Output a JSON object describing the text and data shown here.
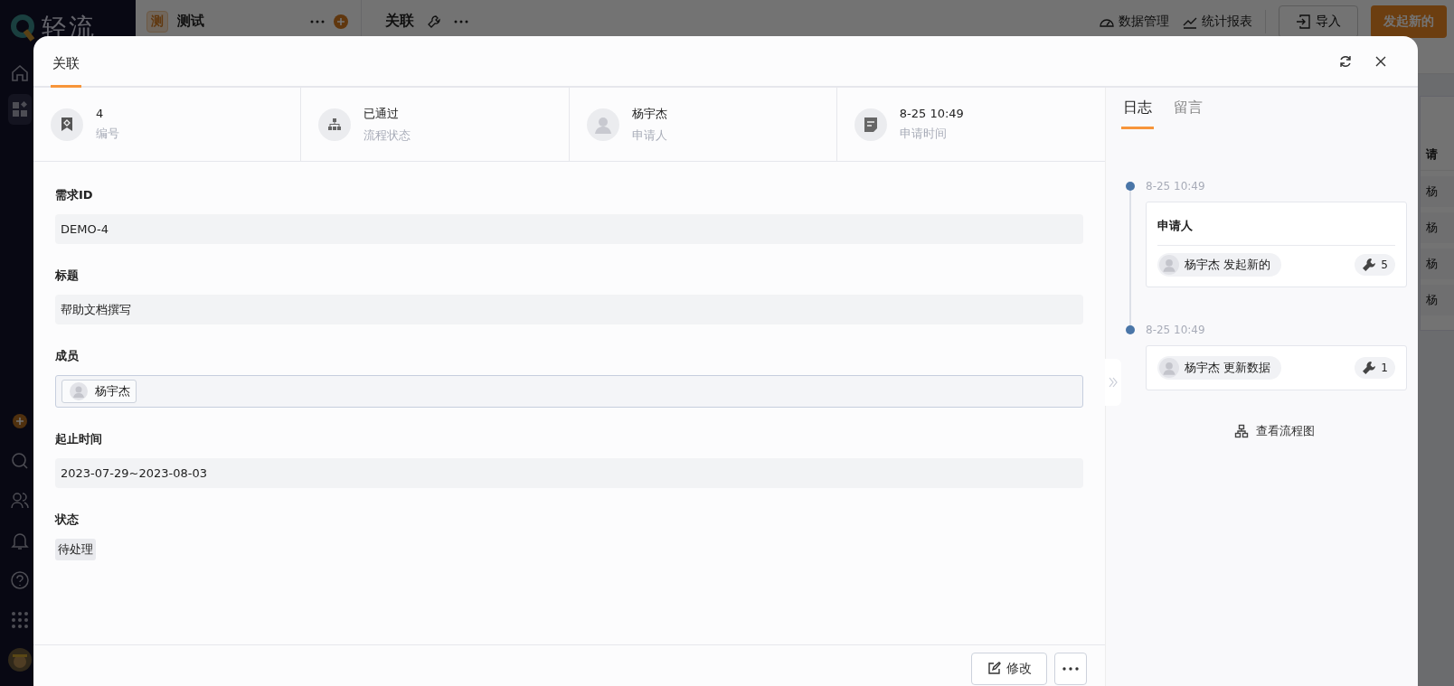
{
  "app": {
    "logo": "轻流",
    "nav": [
      {
        "kind": "home",
        "selected": false
      },
      {
        "kind": "apps",
        "selected": true
      }
    ]
  },
  "workspace": {
    "badge": "测",
    "name": "测试"
  },
  "page": {
    "title": "关联",
    "actions": [
      {
        "kind": "dashboard",
        "label": "数据管理"
      },
      {
        "kind": "chart",
        "label": "统计报表"
      }
    ],
    "import_button": "导入",
    "create_button": "发起新的"
  },
  "table_behind": {
    "column_header": "请",
    "cells": [
      "杨",
      "杨",
      "杨",
      "杨"
    ]
  },
  "modal": {
    "tabs": [
      {
        "label": "关联",
        "selected": true
      }
    ],
    "summary": [
      {
        "kind": "number",
        "value": "4",
        "label": "编号"
      },
      {
        "kind": "flow",
        "value": "已通过",
        "label": "流程状态"
      },
      {
        "kind": "person",
        "value": "杨宇杰",
        "label": "申请人"
      },
      {
        "kind": "time",
        "value": "8-25 10:49",
        "label": "申请时间"
      }
    ],
    "fields": [
      {
        "label": "需求ID",
        "kind": "text",
        "value": "DEMO-4"
      },
      {
        "label": "标题",
        "kind": "text",
        "value": "帮助文档撰写"
      },
      {
        "label": "成员",
        "kind": "members",
        "members": [
          "杨宇杰"
        ]
      },
      {
        "label": "起止时间",
        "kind": "text",
        "value": "2023-07-29~2023-08-03"
      },
      {
        "label": "状态",
        "kind": "tag",
        "value": "待处理"
      }
    ],
    "footer": {
      "edit_button": "修改"
    },
    "side_tabs": [
      {
        "label": "日志",
        "selected": true
      },
      {
        "label": "留言",
        "selected": false
      }
    ],
    "log": [
      {
        "time": "8-25 10:49",
        "title": "申请人",
        "actor": "杨宇杰 发起新的",
        "count": "5"
      },
      {
        "time": "8-25 10:49",
        "actor": "杨宇杰 更新数据",
        "count": "1"
      }
    ],
    "flow_link": "查看流程图"
  }
}
